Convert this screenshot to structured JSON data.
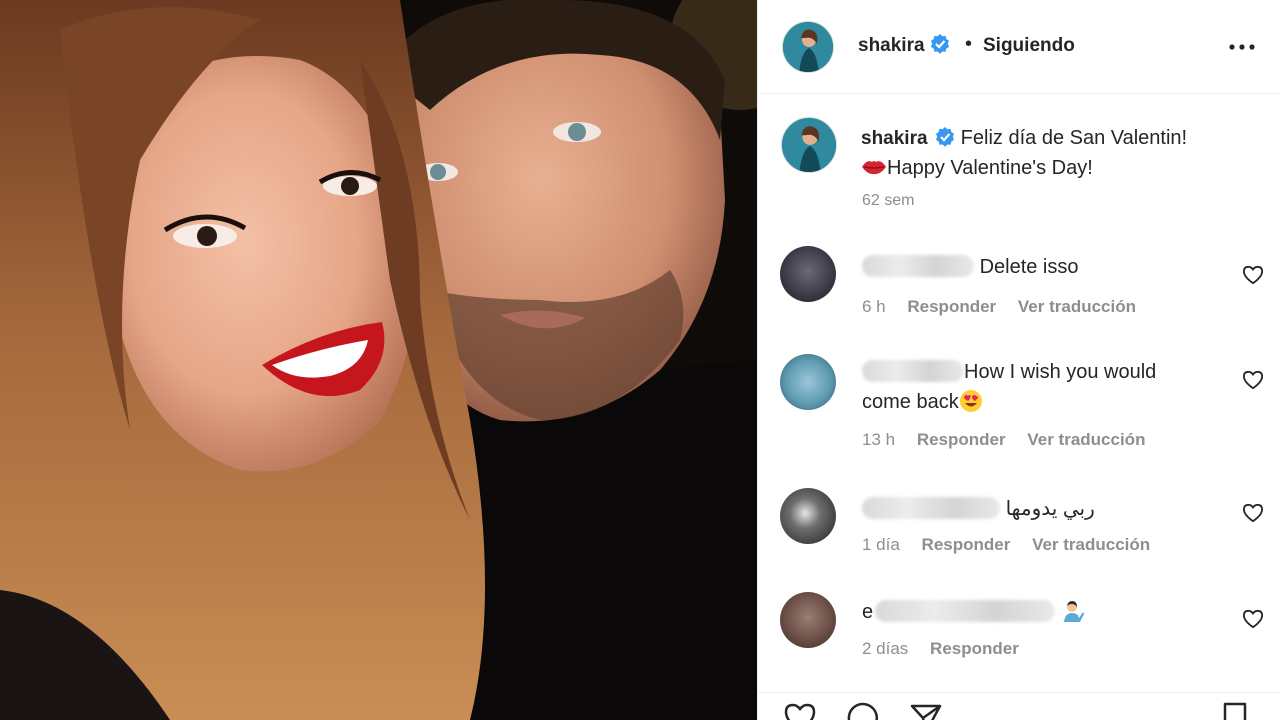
{
  "photo": {
    "alt_subject": "selfie-couple"
  },
  "post": {
    "username": "shakira",
    "separator": "•",
    "follow_status": "Siguiendo",
    "caption": {
      "username": "shakira",
      "line1": "Feliz día de San Valentin!",
      "line2": "Happy Valentine's Day!",
      "emoji": "kiss-lips-icon",
      "time": "62 sem"
    }
  },
  "comments": [
    {
      "text": "Delete isso",
      "time": "6 h",
      "reply": "Responder",
      "translate": "Ver traducción"
    },
    {
      "text_line1": "How I wish you would",
      "text_line2": "come back",
      "emoji": "heart-eyes-icon",
      "time": "13 h",
      "reply": "Responder",
      "translate": "Ver traducción"
    },
    {
      "text": "ربي يدومها",
      "time": "1 día",
      "reply": "Responder",
      "translate": "Ver traducción"
    },
    {
      "text": "e",
      "emoji": "person-tipping-hand-icon",
      "time": "2 días",
      "reply": "Responder"
    }
  ],
  "colors": {
    "verified": "#3897f0",
    "lips": "#d62333",
    "text": "#262626",
    "meta": "#8e8e8e"
  }
}
